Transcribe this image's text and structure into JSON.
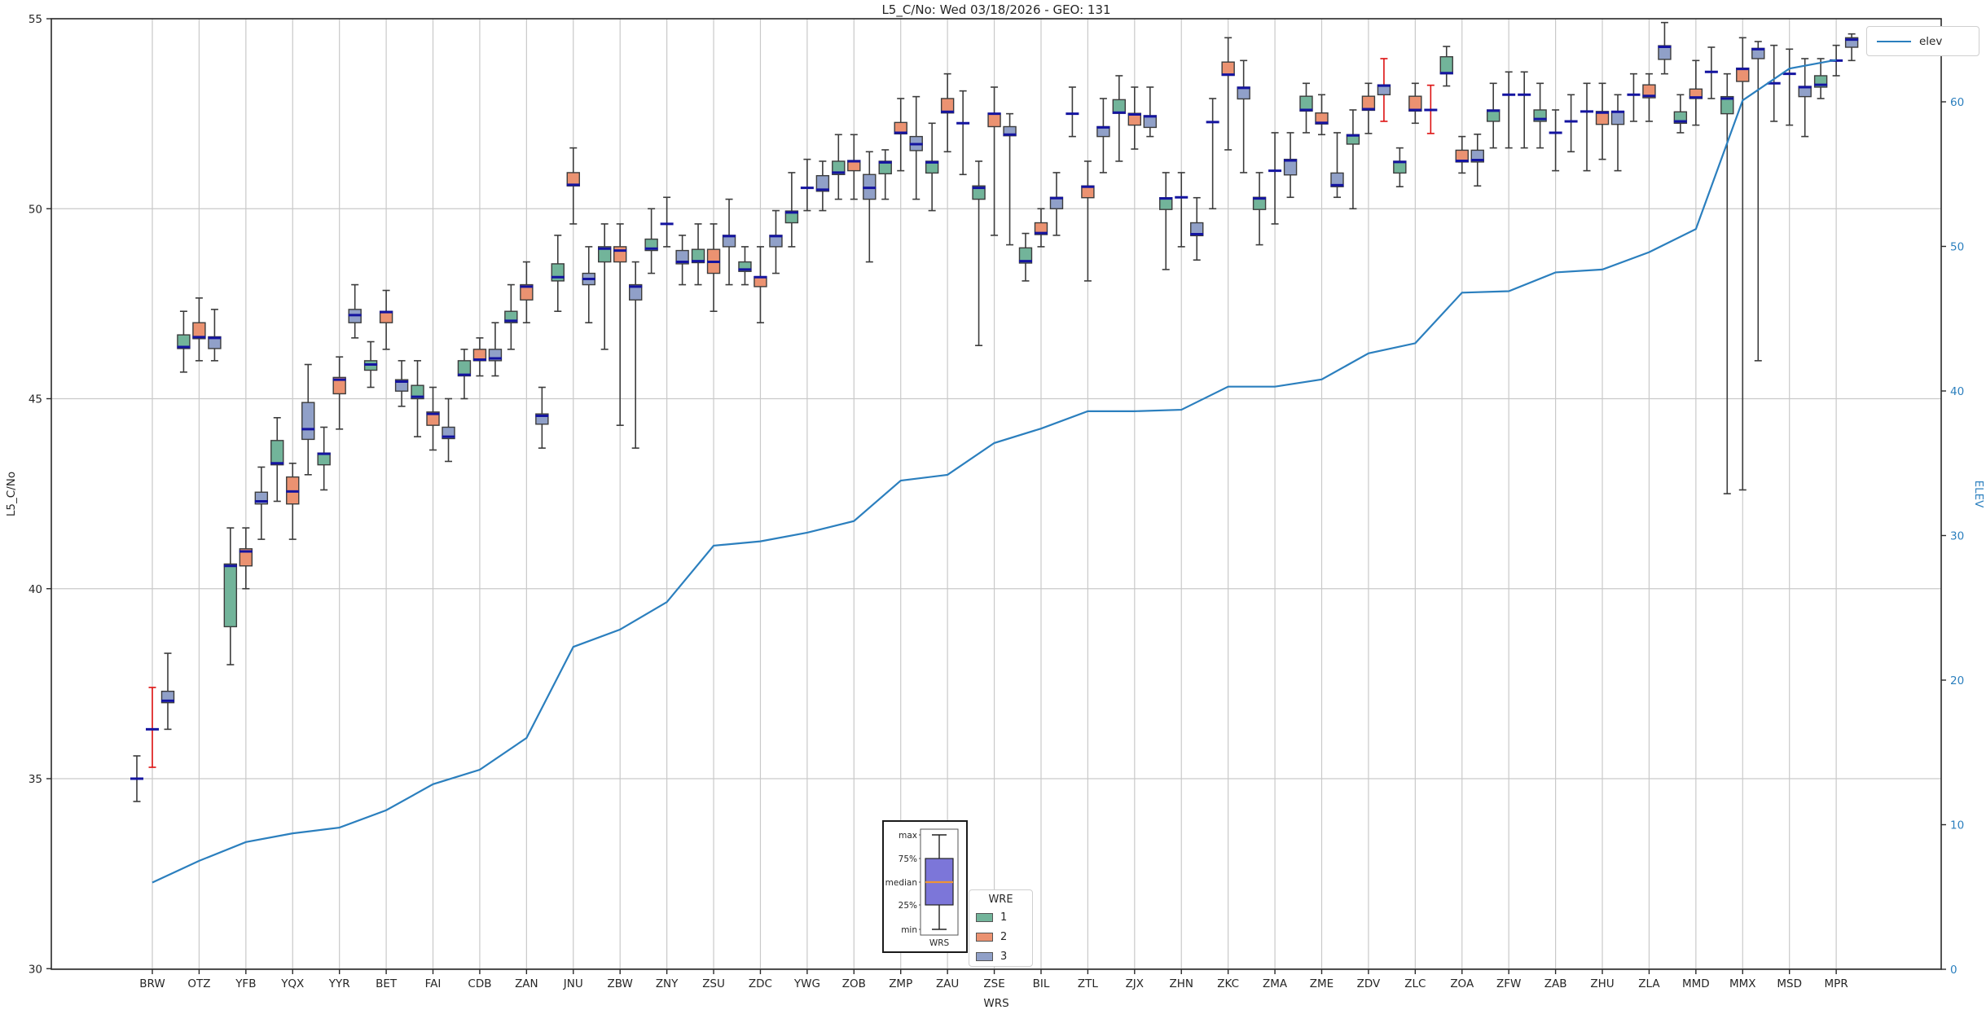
{
  "title": "L5_C/No: Wed 03/18/2026 - GEO: 131",
  "axes": {
    "x_label": "WRS",
    "y_left_label": "L5_C/No",
    "y_right_label": "ELEV",
    "y_left_ticks": [
      30,
      35,
      40,
      45,
      50,
      55
    ],
    "y_right_ticks": [
      0,
      10,
      20,
      30,
      40,
      50,
      60
    ],
    "y_left_range": [
      30,
      55
    ]
  },
  "legends": {
    "elev_label": "elev",
    "wre_title": "WRE",
    "wre_entries": [
      {
        "label": "1",
        "color": "#72b49a"
      },
      {
        "label": "2",
        "color": "#eb9271"
      },
      {
        "label": "3",
        "color": "#90a0c8"
      }
    ]
  },
  "inset": {
    "labels": [
      "max",
      "75%",
      "median",
      "25%",
      "min"
    ],
    "x_label": "WRS",
    "box_color": "#7c76d9",
    "median_color": "#ee9435"
  },
  "colors": {
    "wre1": "#72b49a",
    "wre2": "#eb9271",
    "wre3": "#90a0c8",
    "median": "#1414a0",
    "whisker": "#3c3c3c",
    "red_whisker": "#dd1111",
    "elev_line": "#2b7fbe",
    "grid": "#c9c9c9",
    "frame": "#2a2a2a",
    "right_axis_text": "#2b7fbe"
  },
  "chart_data": {
    "type": "box+line",
    "series_names": [
      "1",
      "2",
      "3"
    ],
    "line_series": "elev",
    "box_value_order": [
      "whisker_lo",
      "q1",
      "median",
      "q3",
      "whisker_hi"
    ],
    "stations": [
      {
        "code": "BRW",
        "elev": 6.0,
        "w1": [
          34.4,
          35.0,
          35.0,
          35.0,
          35.6
        ],
        "w2": [
          35.3,
          36.3,
          36.3,
          36.3,
          37.4
        ],
        "w3": [
          36.3,
          37.0,
          37.05,
          37.3,
          38.3
        ],
        "red": [
          2
        ]
      },
      {
        "code": "OTZ",
        "elev": 7.5,
        "w1": [
          45.7,
          46.32,
          46.36,
          46.68,
          47.3
        ],
        "w2": [
          46.0,
          46.58,
          46.62,
          47.0,
          47.65
        ],
        "w3": [
          46.0,
          46.32,
          46.6,
          46.63,
          47.35
        ],
        "red": []
      },
      {
        "code": "YFB",
        "elev": 8.8,
        "w1": [
          38.0,
          39.0,
          40.6,
          40.65,
          41.6
        ],
        "w2": [
          40.0,
          40.6,
          40.98,
          41.05,
          41.6
        ],
        "w3": [
          41.3,
          42.23,
          42.3,
          42.54,
          43.2
        ],
        "red": []
      },
      {
        "code": "YQX",
        "elev": 9.4,
        "w1": [
          42.3,
          43.26,
          43.3,
          43.9,
          44.5
        ],
        "w2": [
          41.3,
          42.23,
          42.56,
          42.94,
          43.3
        ],
        "w3": [
          43.0,
          43.93,
          44.2,
          44.9,
          45.9
        ],
        "red": []
      },
      {
        "code": "YYR",
        "elev": 9.8,
        "w1": [
          42.6,
          43.26,
          43.55,
          43.57,
          44.25
        ],
        "w2": [
          44.2,
          45.13,
          45.5,
          45.56,
          46.1
        ],
        "w3": [
          46.6,
          47.0,
          47.2,
          47.35,
          48.0
        ],
        "red": []
      },
      {
        "code": "BET",
        "elev": 11.0,
        "w1": [
          45.3,
          45.75,
          45.9,
          46.0,
          46.5
        ],
        "w2": [
          46.3,
          47.0,
          47.28,
          47.3,
          47.85
        ],
        "w3": [
          44.8,
          45.2,
          45.45,
          45.5,
          46.0
        ],
        "red": []
      },
      {
        "code": "FAI",
        "elev": 12.8,
        "w1": [
          44.0,
          45.0,
          45.05,
          45.35,
          46.0
        ],
        "w2": [
          43.65,
          44.3,
          44.6,
          44.65,
          45.3
        ],
        "w3": [
          43.35,
          43.95,
          44.0,
          44.25,
          45.0
        ],
        "red": []
      },
      {
        "code": "CDB",
        "elev": 13.8,
        "w1": [
          45.0,
          45.6,
          45.63,
          46.0,
          46.3
        ],
        "w2": [
          45.6,
          46.0,
          46.03,
          46.3,
          46.6
        ],
        "w3": [
          45.6,
          46.0,
          46.06,
          46.3,
          47.0
        ],
        "red": []
      },
      {
        "code": "ZAN",
        "elev": 16.0,
        "w1": [
          46.3,
          47.0,
          47.05,
          47.3,
          48.0
        ],
        "w2": [
          47.0,
          47.6,
          47.95,
          48.0,
          48.6
        ],
        "w3": [
          43.7,
          44.33,
          44.55,
          44.6,
          45.3
        ],
        "red": []
      },
      {
        "code": "JNU",
        "elev": 22.3,
        "w1": [
          47.3,
          48.1,
          48.2,
          48.55,
          49.3
        ],
        "w2": [
          49.6,
          50.6,
          50.63,
          50.95,
          51.6
        ],
        "w3": [
          47.0,
          48.0,
          48.15,
          48.3,
          49.0
        ],
        "red": []
      },
      {
        "code": "ZBW",
        "elev": 23.5,
        "w1": [
          46.3,
          48.6,
          48.95,
          49.0,
          49.6
        ],
        "w2": [
          44.3,
          48.6,
          48.9,
          49.0,
          49.6
        ],
        "w3": [
          43.7,
          47.6,
          47.95,
          48.0,
          48.6
        ],
        "red": []
      },
      {
        "code": "ZNY",
        "elev": 25.4,
        "w1": [
          48.3,
          48.9,
          48.95,
          49.2,
          50.0
        ],
        "w2": [
          49.0,
          49.6,
          49.6,
          49.6,
          50.3
        ],
        "w3": [
          48.0,
          48.55,
          48.6,
          48.9,
          49.3
        ],
        "red": []
      },
      {
        "code": "ZSU",
        "elev": 29.3,
        "w1": [
          48.0,
          48.58,
          48.62,
          48.93,
          49.6
        ],
        "w2": [
          47.3,
          48.3,
          48.6,
          48.93,
          49.6
        ],
        "w3": [
          48.0,
          49.0,
          49.28,
          49.3,
          50.25
        ],
        "red": []
      },
      {
        "code": "ZDC",
        "elev": 29.6,
        "w1": [
          48.0,
          48.35,
          48.4,
          48.6,
          49.0
        ],
        "w2": [
          47.0,
          47.95,
          48.2,
          48.21,
          49.0
        ],
        "w3": [
          48.3,
          49.0,
          49.28,
          49.3,
          49.95
        ],
        "red": []
      },
      {
        "code": "YWG",
        "elev": 30.2,
        "w1": [
          49.0,
          49.63,
          49.9,
          49.94,
          50.95
        ],
        "w2": [
          49.95,
          50.55,
          50.55,
          50.55,
          51.3
        ],
        "w3": [
          49.95,
          50.46,
          50.5,
          50.87,
          51.25
        ],
        "red": []
      },
      {
        "code": "ZOB",
        "elev": 31.0,
        "w1": [
          50.25,
          50.9,
          50.95,
          51.25,
          51.95
        ],
        "w2": [
          50.25,
          51.0,
          51.25,
          51.27,
          51.95
        ],
        "w3": [
          48.6,
          50.25,
          50.55,
          50.9,
          51.5
        ],
        "red": []
      },
      {
        "code": "ZMP",
        "elev": 33.8,
        "w1": [
          50.25,
          50.92,
          51.22,
          51.25,
          51.55
        ],
        "w2": [
          51.0,
          51.97,
          52.0,
          52.27,
          52.9
        ],
        "w3": [
          50.25,
          51.53,
          51.7,
          51.9,
          52.95
        ],
        "red": []
      },
      {
        "code": "ZAU",
        "elev": 34.2,
        "w1": [
          49.95,
          50.94,
          51.22,
          51.25,
          52.25
        ],
        "w2": [
          51.5,
          52.52,
          52.55,
          52.9,
          53.55
        ],
        "w3": [
          50.9,
          52.25,
          52.25,
          52.25,
          53.1
        ],
        "red": []
      },
      {
        "code": "ZSE",
        "elev": 36.4,
        "w1": [
          46.4,
          50.25,
          50.55,
          50.6,
          51.25
        ],
        "w2": [
          49.3,
          52.16,
          52.5,
          52.51,
          53.2
        ],
        "w3": [
          49.05,
          51.92,
          51.95,
          52.16,
          52.5
        ],
        "red": []
      },
      {
        "code": "BIL",
        "elev": 37.4,
        "w1": [
          48.1,
          48.57,
          48.62,
          48.97,
          49.35
        ],
        "w2": [
          49.0,
          49.32,
          49.36,
          49.63,
          50.0
        ],
        "w3": [
          49.3,
          50.0,
          50.28,
          50.3,
          50.95
        ],
        "red": []
      },
      {
        "code": "ZTL",
        "elev": 38.6,
        "w1": [
          51.9,
          52.5,
          52.5,
          52.5,
          53.2
        ],
        "w2": [
          48.1,
          50.29,
          50.58,
          50.6,
          51.25
        ],
        "w3": [
          50.95,
          51.9,
          52.14,
          52.16,
          52.9
        ],
        "red": []
      },
      {
        "code": "ZJX",
        "elev": 38.6,
        "w1": [
          51.25,
          52.51,
          52.53,
          52.87,
          53.5
        ],
        "w2": [
          51.57,
          52.2,
          52.48,
          52.51,
          53.2
        ],
        "w3": [
          51.9,
          52.14,
          52.43,
          52.45,
          53.2
        ],
        "red": []
      },
      {
        "code": "ZHN",
        "elev": 38.7,
        "w1": [
          48.4,
          49.98,
          50.27,
          50.29,
          50.95
        ],
        "w2": [
          49.0,
          50.3,
          50.3,
          50.3,
          50.95
        ],
        "w3": [
          48.65,
          49.29,
          49.33,
          49.63,
          50.29
        ],
        "red": []
      },
      {
        "code": "ZKC",
        "elev": 40.3,
        "w1": [
          50.0,
          52.28,
          52.28,
          52.28,
          52.9
        ],
        "w2": [
          51.55,
          53.51,
          53.53,
          53.86,
          54.5
        ],
        "w3": [
          50.95,
          52.89,
          53.18,
          53.2,
          53.9
        ],
        "red": []
      },
      {
        "code": "ZMA",
        "elev": 40.3,
        "w1": [
          49.05,
          49.98,
          50.27,
          50.3,
          50.95
        ],
        "w2": [
          49.6,
          51.0,
          51.0,
          51.0,
          52.0
        ],
        "w3": [
          50.3,
          50.89,
          51.27,
          51.3,
          52.0
        ],
        "red": []
      },
      {
        "code": "ZME",
        "elev": 40.8,
        "w1": [
          52.0,
          52.57,
          52.6,
          52.96,
          53.3
        ],
        "w2": [
          51.95,
          52.23,
          52.26,
          52.52,
          53.0
        ],
        "w3": [
          50.3,
          50.58,
          50.62,
          50.94,
          52.0
        ],
        "red": []
      },
      {
        "code": "ZDV",
        "elev": 42.6,
        "w1": [
          50.0,
          51.7,
          51.93,
          51.95,
          52.6
        ],
        "w2": [
          51.98,
          52.59,
          52.62,
          52.96,
          53.3
        ],
        "w3": [
          52.3,
          53.0,
          53.24,
          53.26,
          53.95
        ],
        "red": [
          3
        ]
      },
      {
        "code": "ZLC",
        "elev": 43.3,
        "w1": [
          50.58,
          50.94,
          51.23,
          51.25,
          51.6
        ],
        "w2": [
          52.25,
          52.57,
          52.6,
          52.96,
          53.3
        ],
        "w3": [
          51.98,
          52.6,
          52.6,
          52.6,
          53.25
        ],
        "red": [
          3
        ]
      },
      {
        "code": "ZOA",
        "elev": 46.8,
        "w1": [
          53.23,
          53.55,
          53.57,
          54.0,
          54.27
        ],
        "w2": [
          50.94,
          51.23,
          51.26,
          51.54,
          51.9
        ],
        "w3": [
          50.6,
          51.23,
          51.28,
          51.54,
          51.96
        ],
        "red": []
      },
      {
        "code": "ZFW",
        "elev": 46.9,
        "w1": [
          51.6,
          52.3,
          52.58,
          52.6,
          53.3
        ],
        "w2": [
          51.6,
          53.0,
          53.0,
          53.0,
          53.6
        ],
        "w3": [
          51.6,
          53.0,
          53.0,
          53.0,
          53.6
        ],
        "red": []
      },
      {
        "code": "ZAB",
        "elev": 48.2,
        "w1": [
          51.6,
          52.3,
          52.36,
          52.6,
          53.3
        ],
        "w2": [
          51.0,
          52.0,
          52.0,
          52.0,
          52.6
        ],
        "w3": [
          51.5,
          52.3,
          52.3,
          52.3,
          53.0
        ],
        "red": []
      },
      {
        "code": "ZHU",
        "elev": 48.4,
        "w1": [
          51.0,
          52.56,
          52.56,
          52.56,
          53.3
        ],
        "w2": [
          51.3,
          52.22,
          52.53,
          52.56,
          53.3
        ],
        "w3": [
          51.0,
          52.22,
          52.55,
          52.56,
          53.0
        ],
        "red": []
      },
      {
        "code": "ZLA",
        "elev": 49.6,
        "w1": [
          52.3,
          53.0,
          53.0,
          53.0,
          53.55
        ],
        "w2": [
          52.3,
          52.92,
          52.97,
          53.26,
          53.55
        ],
        "w3": [
          53.55,
          53.93,
          54.26,
          54.29,
          54.9
        ],
        "red": []
      },
      {
        "code": "MMD",
        "elev": 51.2,
        "w1": [
          52.0,
          52.25,
          52.3,
          52.55,
          53.0
        ],
        "w2": [
          52.2,
          52.9,
          52.93,
          53.15,
          53.9
        ],
        "w3": [
          52.9,
          53.6,
          53.6,
          53.6,
          54.25
        ],
        "red": []
      },
      {
        "code": "MMX",
        "elev": 60.1,
        "w1": [
          42.5,
          52.5,
          52.9,
          52.95,
          53.55
        ],
        "w2": [
          42.6,
          53.35,
          53.68,
          53.7,
          54.5
        ],
        "w3": [
          46.0,
          53.95,
          54.2,
          54.22,
          54.4
        ],
        "red": []
      },
      {
        "code": "MSD",
        "elev": 62.3,
        "w1": [
          52.3,
          53.3,
          53.3,
          53.3,
          54.3
        ],
        "w2": [
          52.2,
          53.55,
          53.55,
          53.55,
          54.2
        ],
        "w3": [
          51.9,
          52.95,
          53.2,
          53.22,
          53.95
        ],
        "red": []
      },
      {
        "code": "MPR",
        "elev": 62.9,
        "w1": [
          52.9,
          53.2,
          53.26,
          53.5,
          53.95
        ],
        "w2": [
          53.5,
          53.9,
          53.9,
          53.9,
          54.3
        ],
        "w3": [
          53.9,
          54.25,
          54.45,
          54.5,
          54.6
        ],
        "red": []
      }
    ]
  }
}
